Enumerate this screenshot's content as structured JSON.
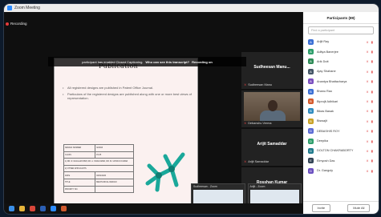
{
  "window": {
    "title": "Zoom Meeting"
  },
  "recording": {
    "label": "Recording"
  },
  "caption": {
    "text": "participant has enabled Closed Captioning.",
    "link": "Who can see this transcript?",
    "status": "Recording on"
  },
  "slide": {
    "title": "Publication",
    "bullets": [
      "All registered designs are published in Patent Office Journal.",
      "Particulars of the registered designs are published along with one or more best views of representation."
    ],
    "table_rows": [
      [
        "DESIGN NUMBER",
        "321843"
      ],
      [
        "CLASS",
        "15-05"
      ],
      [
        "1) DR. R. RAJALAKSHMI, DR. A. SIVAKUMAR, DR. M. UDHAYA KUMAR",
        ""
      ],
      [
        "2) OTHER APPLICANTS",
        ""
      ],
      [
        "DATE",
        "03/02/2020"
      ],
      [
        "TITLE",
        "MECHANICAL DESIGN"
      ],
      [
        "PRIORITY NO.",
        ""
      ]
    ]
  },
  "tiles": [
    {
      "name": "Sudheesan Manu...",
      "sub": "Sudheesan Manu"
    },
    {
      "name": "",
      "sub": "Debanshu Verma"
    },
    {
      "name": "Arijit Samaddar",
      "sub": "Arijit Samaddar"
    },
    {
      "name": "Rosshan Kumar",
      "sub": ""
    }
  ],
  "previews": [
    {
      "title": "Sudheesan - Zoom"
    },
    {
      "title": "Arijit - Zoom"
    }
  ],
  "participants": {
    "title": "Participants (89)",
    "search_placeholder": "Find a participant",
    "items": [
      {
        "initial": "A",
        "name": "Arijit Ray",
        "color": "#3b6fd4"
      },
      {
        "initial": "A",
        "name": "Aditya Banerjee",
        "color": "#2e9e6b"
      },
      {
        "initial": "A",
        "name": "Arik Dutt",
        "color": "#2e8b57"
      },
      {
        "initial": "A",
        "name": "Ajay Shahane",
        "color": "#456"
      },
      {
        "initial": "A",
        "name": "Anantya Bhattacharya",
        "color": "#7b4fbf"
      },
      {
        "initial": "B",
        "name": "Bhanu Rao",
        "color": "#3b6fd4"
      },
      {
        "initial": "B",
        "name": "Biprojit Adhikari",
        "color": "#d45a2b"
      },
      {
        "initial": "B",
        "name": "Bikas Basak",
        "color": "#2e8bc0"
      },
      {
        "initial": "B",
        "name": "Biswajit",
        "color": "#c9a227"
      },
      {
        "initial": "D",
        "name": "DEBASHIS ROY",
        "color": "#5b6bd4"
      },
      {
        "initial": "D",
        "name": "Deepika",
        "color": "#2e9e6b"
      },
      {
        "initial": "D",
        "name": "DOLTON CHAKRABORTY",
        "color": "#1f7a8c"
      },
      {
        "initial": "E",
        "name": "Elmyosh Das",
        "color": "#345"
      },
      {
        "initial": "D",
        "name": "Dr. Ganguly",
        "color": "#6a4fbf"
      }
    ],
    "invite_label": "Invite",
    "mute_label": "Mute All"
  }
}
